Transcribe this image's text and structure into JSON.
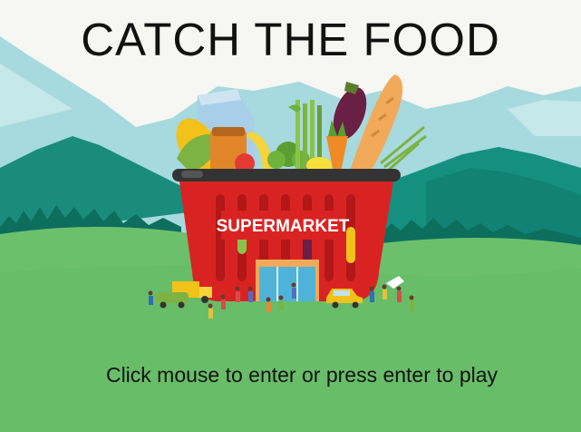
{
  "game": {
    "title": "CATCH THE FOOD",
    "start_prompt": "Click mouse to enter or press enter to play",
    "store_sign": "SUPERMARKET"
  },
  "colors": {
    "sky": "#f6f6f2",
    "mountain_far": "#a6dade",
    "mountain_mid": "#159080",
    "ground": "#6cc06c",
    "basket": "#d92323",
    "text": "#111111"
  }
}
